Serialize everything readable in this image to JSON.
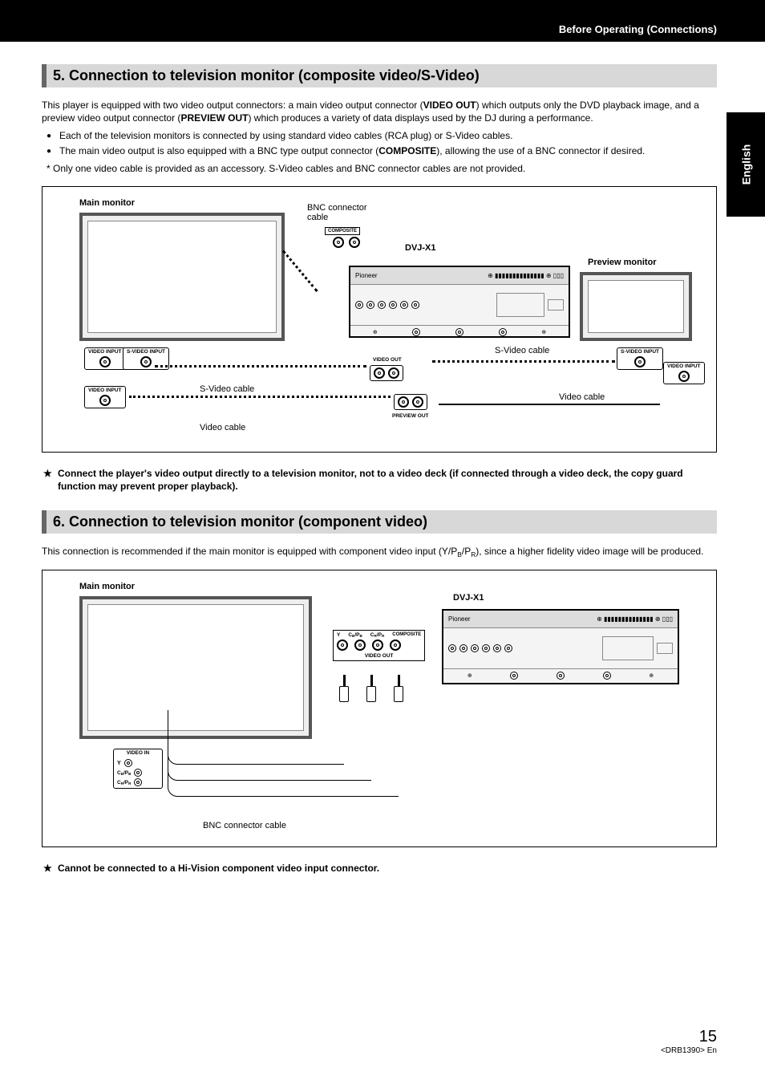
{
  "header": {
    "breadcrumb": "Before Operating (Connections)"
  },
  "lang_tab": "English",
  "section5": {
    "heading": "5. Connection to television monitor (composite video/S-Video)",
    "intro_1a": "This player is equipped with two video output connectors: a main video output connector (",
    "intro_1b": "VIDEO OUT",
    "intro_1c": ") which outputs only the DVD playback image, and a preview video output connector (",
    "intro_1d": "PREVIEW OUT",
    "intro_1e": ") which produces a variety of data displays used by the DJ during a performance.",
    "bullet1": "Each of the television monitors is connected by using standard video cables (RCA plug) or S-Video cables.",
    "bullet2a": "The main video output is also equipped with a BNC type output connector (",
    "bullet2b": "COMPOSITE",
    "bullet2c": "), allowing the use of a BNC connector if desired.",
    "asterisk": "Only one video cable is provided as an accessory. S-Video cables and BNC connector cables are not provided.",
    "star_note": "Connect the player's video output directly to a television monitor, not to a video deck (if connected through a video deck, the copy guard function may prevent proper playback)."
  },
  "diagram1": {
    "main_monitor": "Main monitor",
    "preview_monitor": "Preview monitor",
    "bnc_cable": "BNC connector cable",
    "device_name": "DVJ-X1",
    "svideo_cable": "S-Video cable",
    "video_cable": "Video cable",
    "video_input": "VIDEO INPUT",
    "svideo_input": "S-VIDEO INPUT",
    "composite": "COMPOSITE",
    "video_out": "VIDEO OUT",
    "preview_out": "PREVIEW OUT"
  },
  "section6": {
    "heading": "6. Connection to television monitor (component video)",
    "intro": "This connection is recommended if the main monitor is equipped with component video input (Y/PB/PR), since a higher fidelity video image will be produced.",
    "star_note": "Cannot be connected to a Hi-Vision component video input connector."
  },
  "diagram2": {
    "main_monitor": "Main monitor",
    "device_name": "DVJ-X1",
    "bnc_cable": "BNC connector cable",
    "video_in": "VIDEO IN",
    "y": "Y",
    "cb_pb": "CB/PB",
    "cr_pr": "CR/PR",
    "composite": "COMPOSITE",
    "video_out": "VIDEO OUT"
  },
  "footer": {
    "page": "15",
    "doc_id": "<DRB1390> En"
  }
}
